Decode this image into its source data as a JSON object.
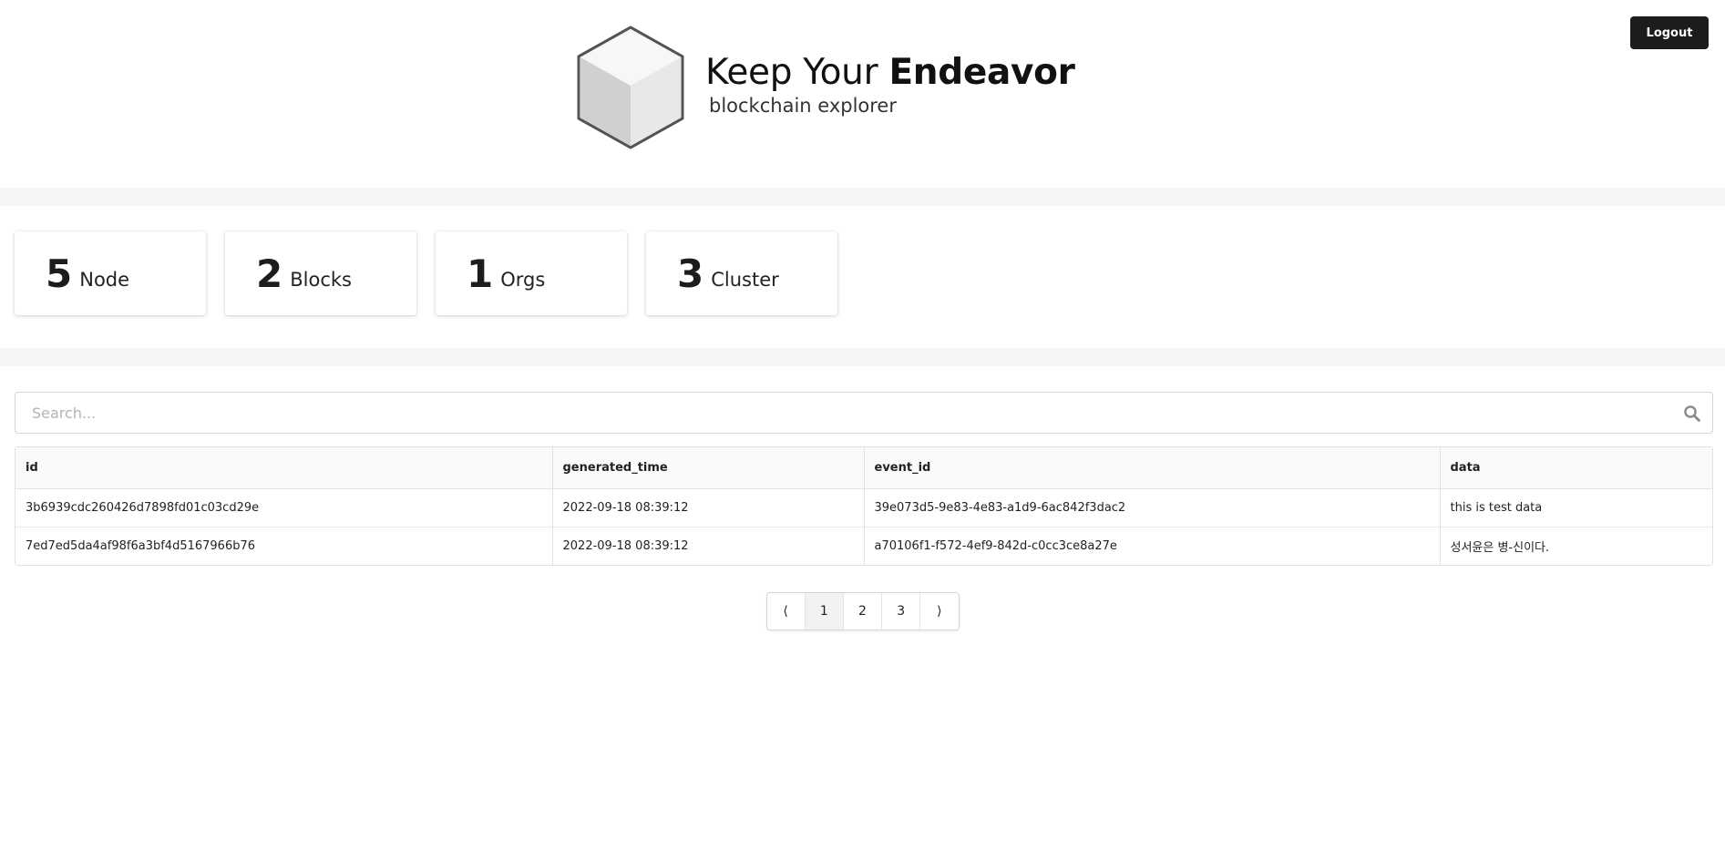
{
  "header": {
    "logout_label": "Logout",
    "logo_title_light": "Keep Your ",
    "logo_title_bold": "Endeavor",
    "logo_subtitle": "blockchain explorer"
  },
  "stats": [
    {
      "value": "5",
      "label": "Node"
    },
    {
      "value": "2",
      "label": "Blocks"
    },
    {
      "value": "1",
      "label": "Orgs"
    },
    {
      "value": "3",
      "label": "Cluster"
    }
  ],
  "search": {
    "placeholder": "Search...",
    "value": ""
  },
  "table": {
    "columns": [
      "id",
      "generated_time",
      "event_id",
      "data"
    ],
    "rows": [
      [
        "3b6939cdc260426d7898fd01c03cd29e",
        "2022-09-18 08:39:12",
        "39e073d5-9e83-4e83-a1d9-6ac842f3dac2",
        "this is test data"
      ],
      [
        "7ed7ed5da4af98f6a3bf4d5167966b76",
        "2022-09-18 08:39:12",
        "a70106f1-f572-4ef9-842d-c0cc3ce8a27e",
        "성서윤은 병-신이다."
      ]
    ]
  },
  "pagination": {
    "prev": "⟨",
    "pages": [
      "1",
      "2",
      "3"
    ],
    "active": "1",
    "next": "⟩"
  },
  "icons": {
    "search": "search-icon",
    "logo": "cube-icon"
  },
  "colors": {
    "logout_bg": "#1b1c1d",
    "band": "#f5f5f5",
    "active_page": "#f2f2f2"
  }
}
